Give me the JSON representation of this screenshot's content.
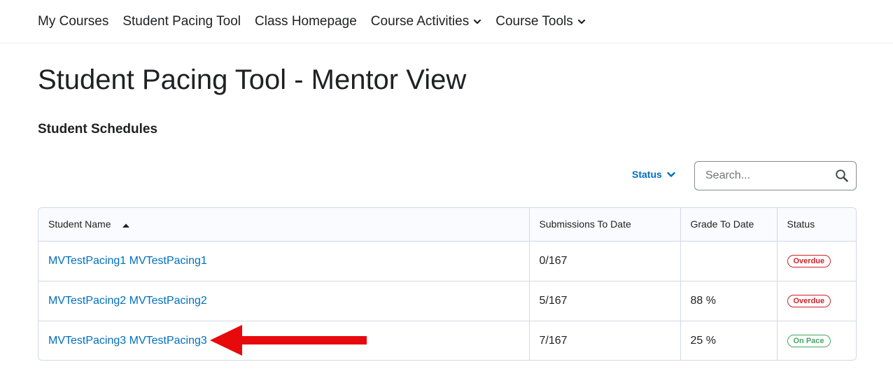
{
  "nav": {
    "items": [
      {
        "label": "My Courses",
        "has_menu": false
      },
      {
        "label": "Student Pacing Tool",
        "has_menu": false
      },
      {
        "label": "Class Homepage",
        "has_menu": false
      },
      {
        "label": "Course Activities",
        "has_menu": true
      },
      {
        "label": "Course Tools",
        "has_menu": true
      }
    ]
  },
  "page": {
    "title": "Student Pacing Tool - Mentor View",
    "section_title": "Student Schedules"
  },
  "filters": {
    "status_label": "Status",
    "search_placeholder": "Search..."
  },
  "table": {
    "columns": [
      "Student Name",
      "Submissions To Date",
      "Grade To Date",
      "Status"
    ],
    "sort_icon": "caret-up-icon",
    "rows": [
      {
        "student": "MVTestPacing1 MVTestPacing1",
        "submissions": "0/167",
        "grade": "",
        "status": "Overdue",
        "status_color": "#cd2026"
      },
      {
        "student": "MVTestPacing2 MVTestPacing2",
        "submissions": "5/167",
        "grade": "88 %",
        "status": "Overdue",
        "status_color": "#cd2026"
      },
      {
        "student": "MVTestPacing3 MVTestPacing3",
        "submissions": "7/167",
        "grade": "25 %",
        "status": "On Pace",
        "status_color": "#46a661"
      }
    ]
  },
  "colors": {
    "link": "#006fbf",
    "annotation_arrow": "#e8090c"
  }
}
